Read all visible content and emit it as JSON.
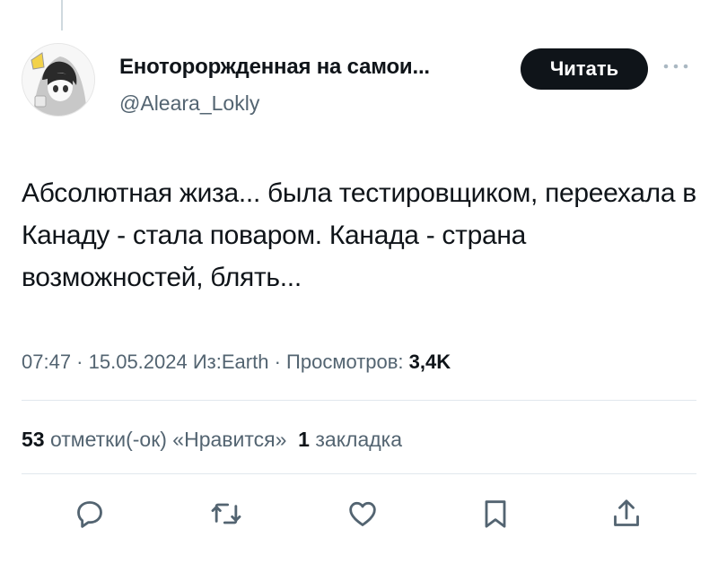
{
  "tweet": {
    "author": {
      "display_name": "Енотороржденная на самои...",
      "handle": "@Aleara_Lokly"
    },
    "follow_label": "Читать",
    "text": "Абсолютная жиза... была тестировщиком, переехала в Канаду - стала поваром. Канада - страна возможностей, блять...",
    "meta": {
      "time": "07:47",
      "separator": " · ",
      "date": "15.05.2024",
      "source": "Из:Earth",
      "views_label": "Просмотров:",
      "views_count": "3,4K"
    },
    "stats": {
      "likes_count": "53",
      "likes_label": "отметки(-ок) «Нравится»",
      "bookmarks_count": "1",
      "bookmarks_label": "закладка"
    }
  },
  "icons": {
    "reply": "reply-icon",
    "retweet": "retweet-icon",
    "like": "heart-icon",
    "bookmark": "bookmark-icon",
    "share": "share-icon",
    "more": "more-icon"
  },
  "colors": {
    "text_primary": "#0f1419",
    "text_secondary": "#536471",
    "button_bg": "#0f1419",
    "divider": "#e1e8ed"
  }
}
